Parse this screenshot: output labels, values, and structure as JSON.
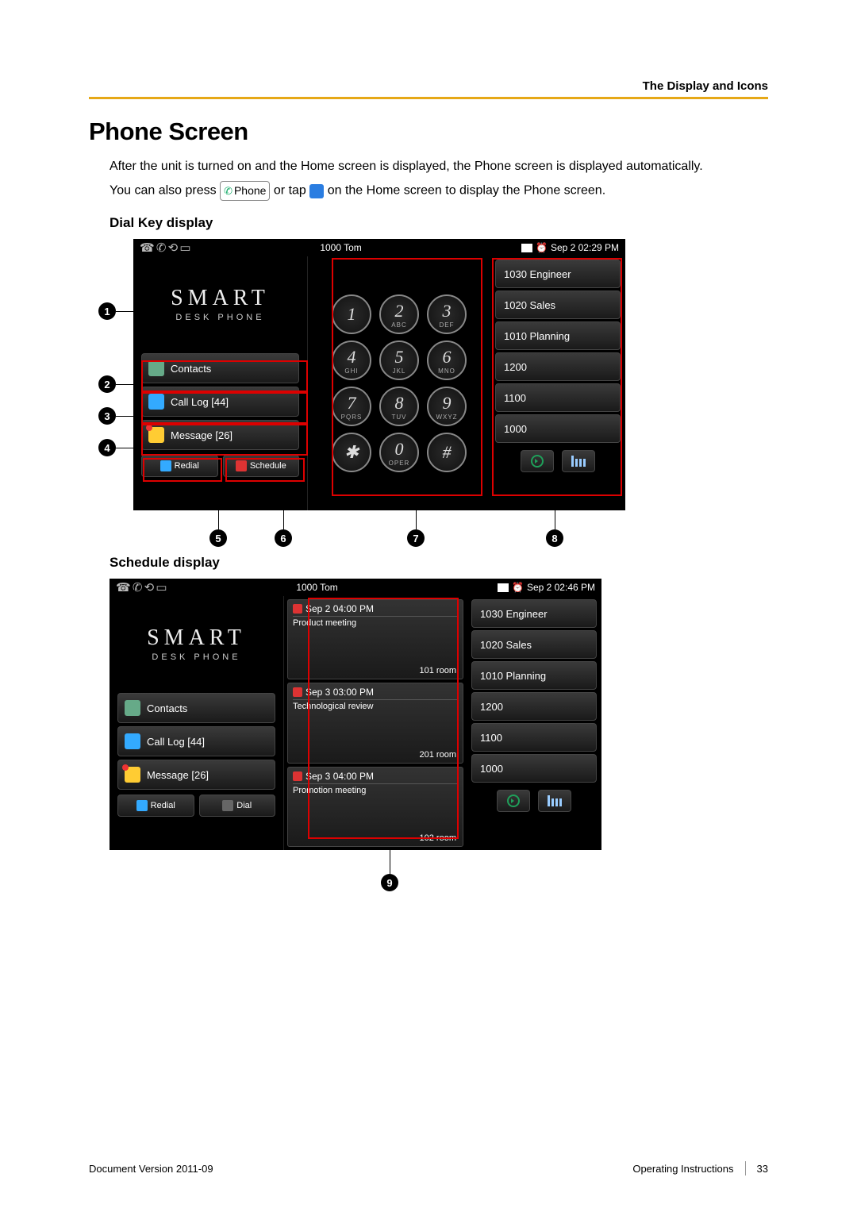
{
  "page_header": {
    "section_title": "The Display and Icons"
  },
  "h1": "Phone Screen",
  "intro_line1": "After the unit is turned on and the Home screen is displayed, the Phone screen is displayed automatically.",
  "intro_prefix": "You can also press ",
  "intro_btn_label": "Phone",
  "intro_mid": " or tap ",
  "intro_suffix": " on the Home screen to display the Phone screen.",
  "sub1": "Dial Key display",
  "sub2": "Schedule display",
  "screen1": {
    "status": {
      "center": "1000  Tom",
      "right_time": "Sep 2 02:29 PM"
    },
    "logo": {
      "main": "SMART",
      "sub": "DESK PHONE"
    },
    "nav": {
      "contacts": "Contacts",
      "calllog": "Call Log [44]",
      "message": "Message [26]"
    },
    "mini": {
      "redial": "Redial",
      "schedule": "Schedule"
    },
    "keys": [
      {
        "n": "1",
        "s": ""
      },
      {
        "n": "2",
        "s": "ABC"
      },
      {
        "n": "3",
        "s": "DEF"
      },
      {
        "n": "4",
        "s": "GHI"
      },
      {
        "n": "5",
        "s": "JKL"
      },
      {
        "n": "6",
        "s": "MNO"
      },
      {
        "n": "7",
        "s": "PQRS"
      },
      {
        "n": "8",
        "s": "TUV"
      },
      {
        "n": "9",
        "s": "WXYZ"
      },
      {
        "n": "✱",
        "s": ""
      },
      {
        "n": "0",
        "s": "OPER"
      },
      {
        "n": "#",
        "s": ""
      }
    ],
    "speed": [
      "1030 Engineer",
      "1020 Sales",
      "1010 Planning",
      "1200",
      "1100",
      "1000"
    ]
  },
  "screen2": {
    "status": {
      "center": "1000  Tom",
      "right_time": "Sep 2 02:46 PM"
    },
    "logo": {
      "main": "SMART",
      "sub": "DESK PHONE"
    },
    "nav": {
      "contacts": "Contacts",
      "calllog": "Call Log [44]",
      "message": "Message [26]"
    },
    "mini": {
      "redial": "Redial",
      "dial": "Dial"
    },
    "schedule": [
      {
        "time": "Sep 2 04:00 PM",
        "title": "Product meeting",
        "room": "101 room"
      },
      {
        "time": "Sep 3 03:00 PM",
        "title": "Technological  review",
        "room": "201 room"
      },
      {
        "time": "Sep 3 04:00 PM",
        "title": "Promotion meeting",
        "room": "102 room"
      }
    ],
    "speed": [
      "1030 Engineer",
      "1020 Sales",
      "1010 Planning",
      "1200",
      "1100",
      "1000"
    ]
  },
  "callouts": {
    "c1": "1",
    "c2": "2",
    "c3": "3",
    "c4": "4",
    "c5": "5",
    "c6": "6",
    "c7": "7",
    "c8": "8",
    "c9": "9"
  },
  "footer": {
    "left": "Document Version  2011-09",
    "right_label": "Operating Instructions",
    "page_num": "33"
  }
}
